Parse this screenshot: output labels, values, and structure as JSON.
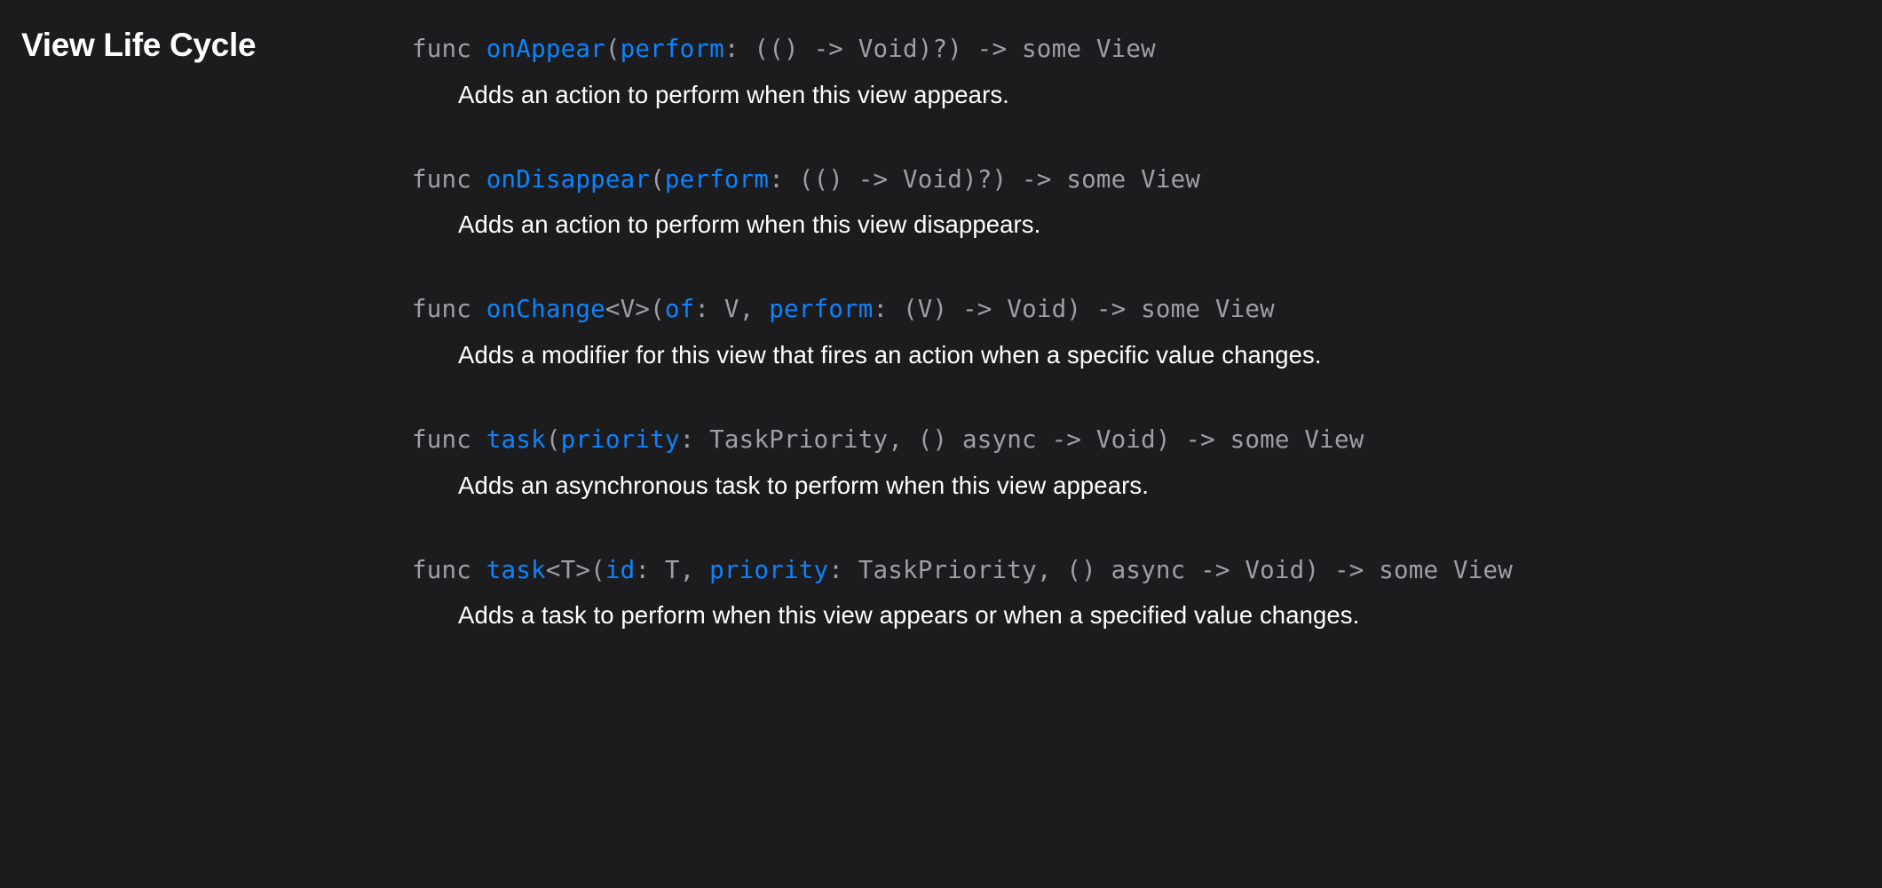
{
  "section": {
    "title": "View Life Cycle"
  },
  "items": [
    {
      "sig": {
        "pre": "func ",
        "name": "onAppear",
        "post1": "(",
        "param1": "perform",
        "post2": ": (() -> Void)?) -> some View"
      },
      "desc": "Adds an action to perform when this view appears."
    },
    {
      "sig": {
        "pre": "func ",
        "name": "onDisappear",
        "post1": "(",
        "param1": "perform",
        "post2": ": (() -> Void)?) -> some View"
      },
      "desc": "Adds an action to perform when this view disappears."
    },
    {
      "sig": {
        "pre": "func ",
        "name": "onChange",
        "post1": "<V>(",
        "param1": "of",
        "mid1": ": V, ",
        "param2": "perform",
        "post2": ": (V) -> Void) -> some View"
      },
      "desc": "Adds a modifier for this view that fires an action when a specific value changes."
    },
    {
      "sig": {
        "pre": "func ",
        "name": "task",
        "post1": "(",
        "param1": "priority",
        "post2": ": TaskPriority, () async -> Void) -> some View"
      },
      "desc": "Adds an asynchronous task to perform when this view appears."
    },
    {
      "sig": {
        "pre": "func ",
        "name": "task",
        "post1": "<T>(",
        "param1": "id",
        "mid1": ": T, ",
        "param2": "priority",
        "post2": ": TaskPriority, () async -> Void) -> some View"
      },
      "desc": "Adds a task to perform when this view appears or when a specified value changes."
    }
  ]
}
